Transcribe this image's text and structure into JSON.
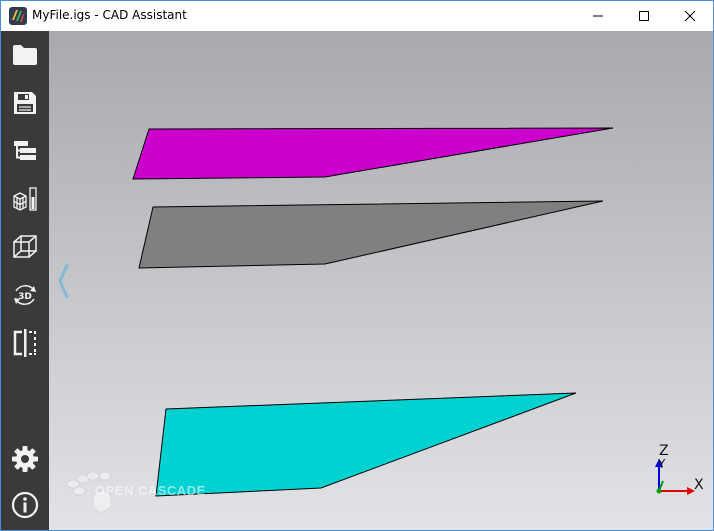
{
  "window": {
    "title": "MyFile.igs - CAD Assistant",
    "controls": [
      "minimize",
      "maximize",
      "close"
    ]
  },
  "sidebar": {
    "top_items": [
      {
        "icon": "folder-icon",
        "tooltip": ""
      },
      {
        "icon": "save-icon",
        "tooltip": ""
      },
      {
        "icon": "model-tree-icon",
        "tooltip": ""
      },
      {
        "icon": "display-mode-icon",
        "tooltip": ""
      },
      {
        "icon": "wireframe-cube-icon",
        "tooltip": ""
      },
      {
        "icon": "3d-rotate-icon",
        "tooltip": ""
      },
      {
        "icon": "clipping-plane-icon",
        "tooltip": ""
      }
    ],
    "bottom_items": [
      {
        "icon": "gear-icon"
      },
      {
        "icon": "info-icon"
      }
    ]
  },
  "viewport": {
    "shapes": [
      {
        "name": "magenta-face",
        "color": "#cc00cc"
      },
      {
        "name": "gray-face",
        "color": "#808080"
      },
      {
        "name": "cyan-face",
        "color": "#00d2d2"
      }
    ],
    "background_top": "#a7a9ae",
    "background_bottom": "#e2e3e6",
    "watermark": "OPEN CASCADE",
    "axes": {
      "z_label": "Z",
      "y_label": "Y",
      "x_label": "X"
    },
    "axis_colors": {
      "x": "#e00000",
      "y": "#00a000",
      "z": "#0000e0"
    }
  }
}
